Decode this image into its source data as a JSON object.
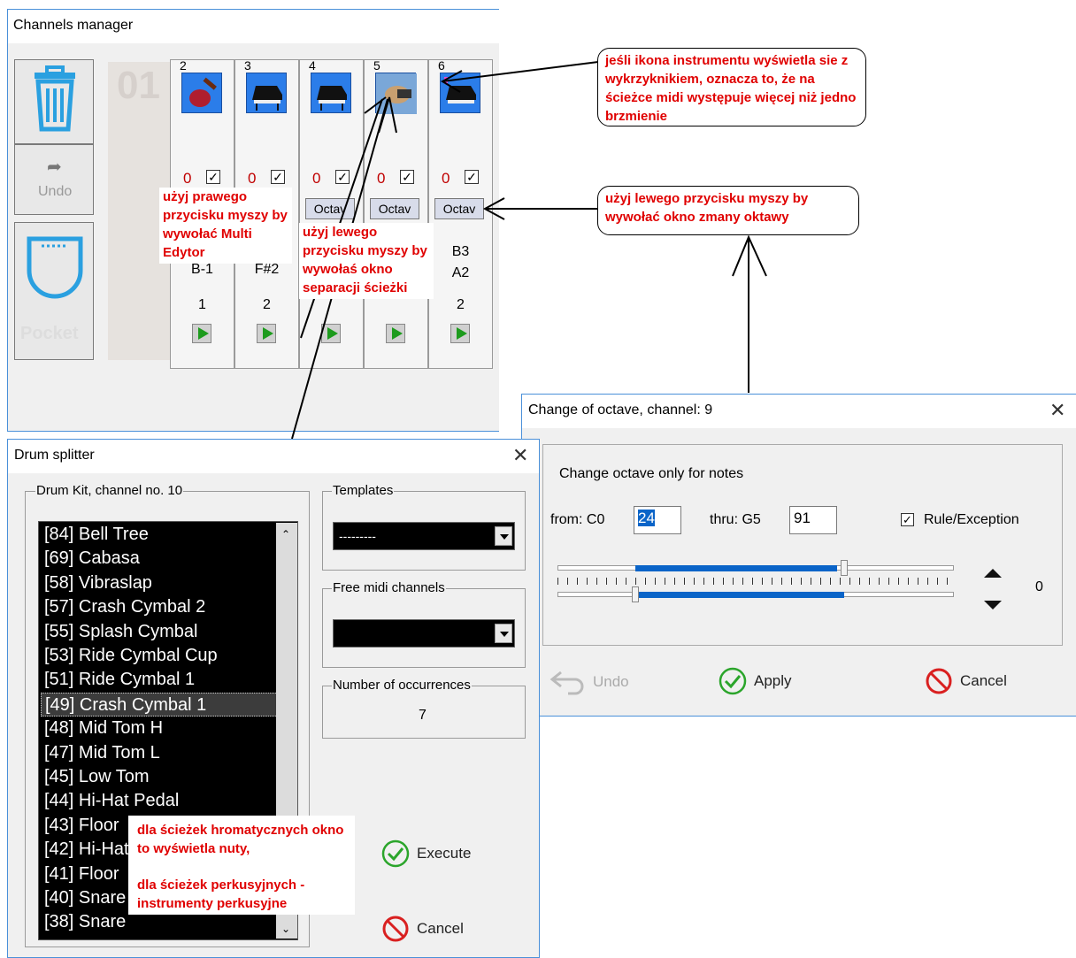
{
  "channels_manager": {
    "title": "Channels manager",
    "undo_label": "Undo",
    "pocket_label": "Pocket",
    "big_channel_number": "01",
    "channels": [
      {
        "number": "2",
        "red_value": "0",
        "checked": true,
        "octav": "",
        "note1": "B-1",
        "note2": "",
        "count": "1"
      },
      {
        "number": "3",
        "red_value": "0",
        "checked": true,
        "octav": "",
        "note1": "F#2",
        "note2": "",
        "count": "2"
      },
      {
        "number": "4",
        "red_value": "0",
        "checked": true,
        "octav": "Octav",
        "note1": "",
        "note2": "",
        "count": ""
      },
      {
        "number": "5",
        "red_value": "0",
        "checked": true,
        "octav": "Octav",
        "note1": "",
        "note2": "",
        "count": ""
      },
      {
        "number": "6",
        "red_value": "0",
        "checked": true,
        "octav": "Octav",
        "note1": "B3",
        "note2": "A2",
        "count": "2"
      }
    ]
  },
  "annotations": {
    "icon_warning": "jeśli ikona instrumentu wyświetla sie z wykrzyknikiem, oznacza to, że na ścieżce midi występuje więcej niż jedno brzmienie",
    "left_click_octave": "użyj lewego przycisku myszy by wywołać okno zmany oktawy",
    "right_click_multi": "użyj prawego przycisku myszy by wywołać Multi Edytor",
    "left_click_split": "użyj lewego przycisku myszy by wywołaś okno separacji ścieżki",
    "chromatic_note": "dla ścieżek hromatycznych okno to wyświetla nuty,",
    "percussion_note": "dla ścieżek perkusyjnych - instrumenty perkusyjne"
  },
  "drum_splitter": {
    "title": "Drum splitter",
    "group_label": "Drum Kit, channel no. 10",
    "items": [
      "[84] Bell Tree",
      "[69] Cabasa",
      "[58] Vibraslap",
      "[57] Crash Cymbal 2",
      "[55] Splash Cymbal",
      "[53] Ride Cymbal Cup",
      "[51] Ride Cymbal 1",
      "[49] Crash Cymbal 1",
      "[48] Mid Tom H",
      "[47] Mid Tom L",
      "[45] Low Tom",
      "[44] Hi-Hat Pedal",
      "[43] Floor",
      "[42] Hi-Hat",
      "[41] Floor",
      "[40] Snare",
      "[38] Snare"
    ],
    "selected_index": 7,
    "templates_label": "Templates",
    "templates_value": "---------",
    "free_midi_label": "Free midi channels",
    "free_midi_value": "",
    "occurrences_label": "Number of occurrences",
    "occurrences_value": "7",
    "execute_label": "Execute",
    "cancel_label": "Cancel"
  },
  "octave_dialog": {
    "title": "Change of octave, channel: 9",
    "subtitle": "Change octave only for notes",
    "from_label": "from: C0",
    "from_value": "24",
    "thru_label": "thru: G5",
    "thru_value": "91",
    "rule_label": "Rule/Exception",
    "rule_checked": true,
    "spin_value": "0",
    "undo_label": "Undo",
    "apply_label": "Apply",
    "cancel_label": "Cancel"
  },
  "colors": {
    "accent": "#2b7de9",
    "annotation_red": "#e00000",
    "channel_red": "#c00000",
    "slider_blue": "#0a64c8"
  }
}
